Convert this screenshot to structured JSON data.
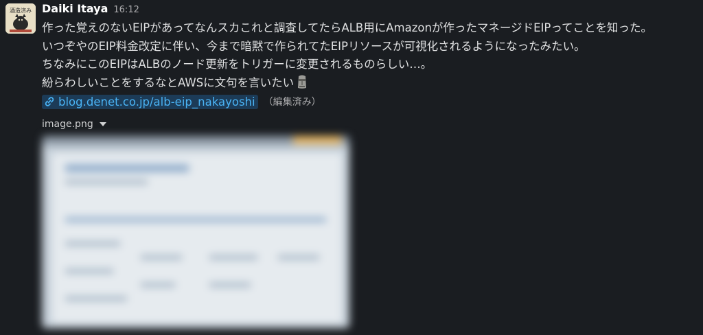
{
  "message": {
    "author": "Daiki Itaya",
    "timestamp": "16:12",
    "lines": [
      "作った覚えのないEIPがあってなんスカこれと調査してたらALB用にAmazonが作ったマネージドEIPってことを知った。",
      "いつぞやのEIP料金改定に伴い、今まで暗黙で作られてたEIPリソースが可視化されるようになったみたい。",
      "ちなみにこのEIPはALBのノード更新をトリガーに変更されるものらしい…。",
      "紛らわしいことをするなとAWSに文句を言いたい"
    ],
    "emoji": "moai",
    "link_text": "blog.denet.co.jp/alb-eip_nakayoshi",
    "edited_label": "（編集済み）",
    "attachment_name": "image.png",
    "avatar_label": "酒造済み"
  },
  "colors": {
    "background": "#1a1d21",
    "author": "#ffffff",
    "text": "#e0e1e2",
    "link": "#4ab3f4",
    "link_bg": "#1c3b57",
    "muted": "#ababad"
  }
}
